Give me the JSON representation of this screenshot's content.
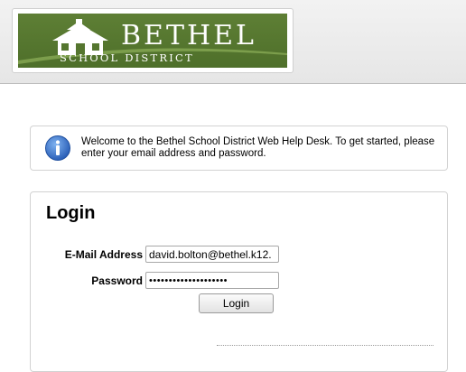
{
  "header": {
    "logo": {
      "title": "BETHEL",
      "subtitle": "SCHOOL DISTRICT"
    }
  },
  "welcome": {
    "message": "Welcome to the Bethel School District Web Help Desk. To get started, please enter your email address and password.",
    "icon": "info-icon"
  },
  "login": {
    "heading": "Login",
    "email_label": "E-Mail Address",
    "email_value": "david.bolton@bethel.k12.",
    "password_label": "Password",
    "password_value": "••••••••••••••••••••",
    "button_label": "Login"
  },
  "colors": {
    "logo_green": "#55762f",
    "info_blue": "#2f6fc8"
  }
}
